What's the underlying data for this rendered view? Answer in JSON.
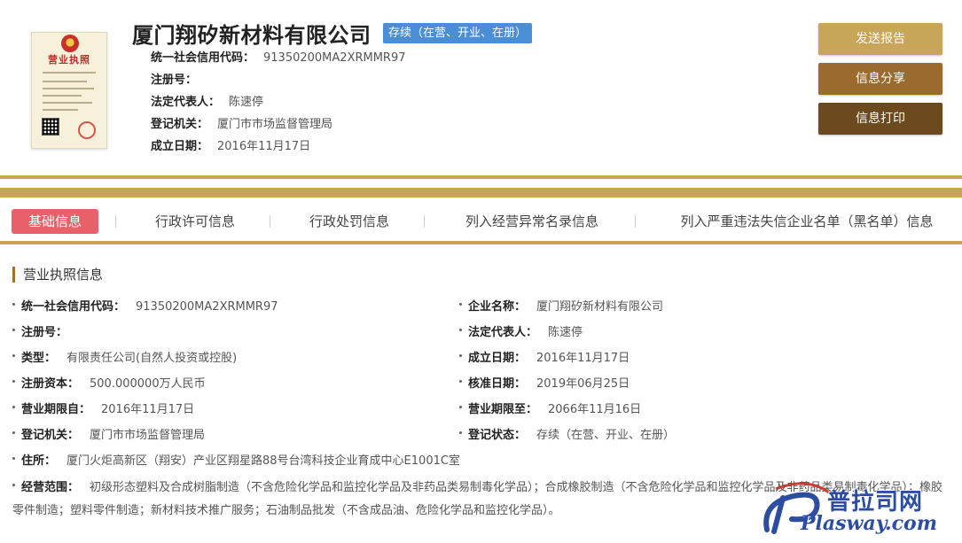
{
  "header": {
    "license_image_label": "营业执照",
    "company_name": "厦门翔矽新材料有限公司",
    "status_badge": "存续（在营、开业、在册）",
    "credit_code_label": "统一社会信用代码：",
    "credit_code": "91350200MA2XRMMR97",
    "reg_no_label": "注册号：",
    "reg_no": "",
    "legal_rep_label": "法定代表人：",
    "legal_rep": "陈速停",
    "authority_label": "登记机关：",
    "authority": "厦门市市场监督管理局",
    "established_label": "成立日期：",
    "established": "2016年11月17日"
  },
  "actions": {
    "report": "发送报告",
    "share": "信息分享",
    "print": "信息打印"
  },
  "tabs": [
    {
      "label": "基础信息",
      "active": true
    },
    {
      "label": "行政许可信息",
      "active": false
    },
    {
      "label": "行政处罚信息",
      "active": false
    },
    {
      "label": "列入经营异常名录信息",
      "active": false
    },
    {
      "label": "列入严重违法失信企业名单（黑名单）信息",
      "active": false
    }
  ],
  "section": {
    "title": "营业执照信息",
    "left": [
      {
        "k": "统一社会信用代码：",
        "v": "91350200MA2XRMMR97"
      },
      {
        "k": "注册号：",
        "v": ""
      },
      {
        "k": "类型：",
        "v": "有限责任公司(自然人投资或控股)"
      },
      {
        "k": "注册资本：",
        "v": "500.000000万人民币"
      },
      {
        "k": "营业期限自：",
        "v": "2016年11月17日"
      },
      {
        "k": "登记机关：",
        "v": "厦门市市场监督管理局"
      },
      {
        "k": "住所：",
        "v": "厦门火炬高新区（翔安）产业区翔星路88号台湾科技企业育成中心E1001C室"
      }
    ],
    "right": [
      {
        "k": "企业名称：",
        "v": "厦门翔矽新材料有限公司"
      },
      {
        "k": "法定代表人：",
        "v": "陈速停"
      },
      {
        "k": "成立日期：",
        "v": "2016年11月17日"
      },
      {
        "k": "核准日期：",
        "v": "2019年06月25日"
      },
      {
        "k": "营业期限至：",
        "v": "2066年11月16日"
      },
      {
        "k": "登记状态：",
        "v": "存续（在营、开业、在册）"
      }
    ],
    "scope_label": "经营范围：",
    "scope": "初级形态塑料及合成树脂制造（不含危险化学品和监控化学品及非药品类易制毒化学品）；合成橡胶制造（不含危险化学品和监控化学品及非药品类易制毒化学品）；橡胶零件制造；塑料零件制造；新材料技术推广服务；石油制品批发（不含成品油、危险化学品和监控化学品）。"
  },
  "watermark": {
    "cn": "普拉司网",
    "en": "Plasway.com"
  },
  "colors": {
    "gold": "#c8a454",
    "active_tab": "#e8606a",
    "status_badge": "#4a8fd6",
    "btn_report": "#c9a55a",
    "btn_share": "#9a6b2c",
    "btn_print": "#6b4a1d"
  }
}
